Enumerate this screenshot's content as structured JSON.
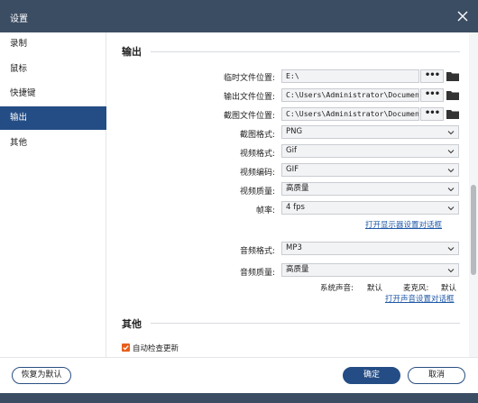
{
  "window": {
    "title": "设置"
  },
  "sidebar": {
    "items": [
      {
        "label": "录制"
      },
      {
        "label": "鼠标"
      },
      {
        "label": "快捷键"
      },
      {
        "label": "输出",
        "active": true
      },
      {
        "label": "其他"
      }
    ]
  },
  "output": {
    "heading": "输出",
    "temp_folder": {
      "label": "临时文件位置:",
      "value": "E:\\"
    },
    "output_folder": {
      "label": "输出文件位置:",
      "value": "C:\\Users\\Administrator\\Documents"
    },
    "screenshot_folder": {
      "label": "截图文件位置:",
      "value": "C:\\Users\\Administrator\\Documents"
    },
    "browse_label": "•••",
    "screenshot_format": {
      "label": "截图格式:",
      "value": "PNG"
    },
    "video_format": {
      "label": "视频格式:",
      "value": "Gif"
    },
    "video_codec": {
      "label": "视频编码:",
      "value": "GIF"
    },
    "video_quality": {
      "label": "视频质量:",
      "value": "高质量"
    },
    "frame_rate": {
      "label": "帧率:",
      "value": "4 fps"
    },
    "display_settings_link": "打开显示器设置对话框",
    "audio_format": {
      "label": "音频格式:",
      "value": "MP3"
    },
    "audio_quality": {
      "label": "音频质量:",
      "value": "高质量"
    },
    "system_sound": {
      "label": "系统声音:",
      "value": "默认"
    },
    "microphone": {
      "label": "麦克风:",
      "value": "默认"
    },
    "sound_settings_link": "打开声音设置对话框"
  },
  "other": {
    "heading": "其他",
    "auto_update": {
      "label": "自动检查更新",
      "checked": true
    }
  },
  "footer": {
    "reset_label": "恢复为默认",
    "ok_label": "确定",
    "cancel_label": "取消"
  },
  "colors": {
    "titlebar": "#3b4d63",
    "accent": "#244d85",
    "link": "#2058a8",
    "checkbox": "#e65f1c"
  },
  "icons": {
    "close": "close-icon",
    "folder": "folder-icon",
    "dropdown": "chevron-down-icon",
    "check": "check-icon"
  }
}
